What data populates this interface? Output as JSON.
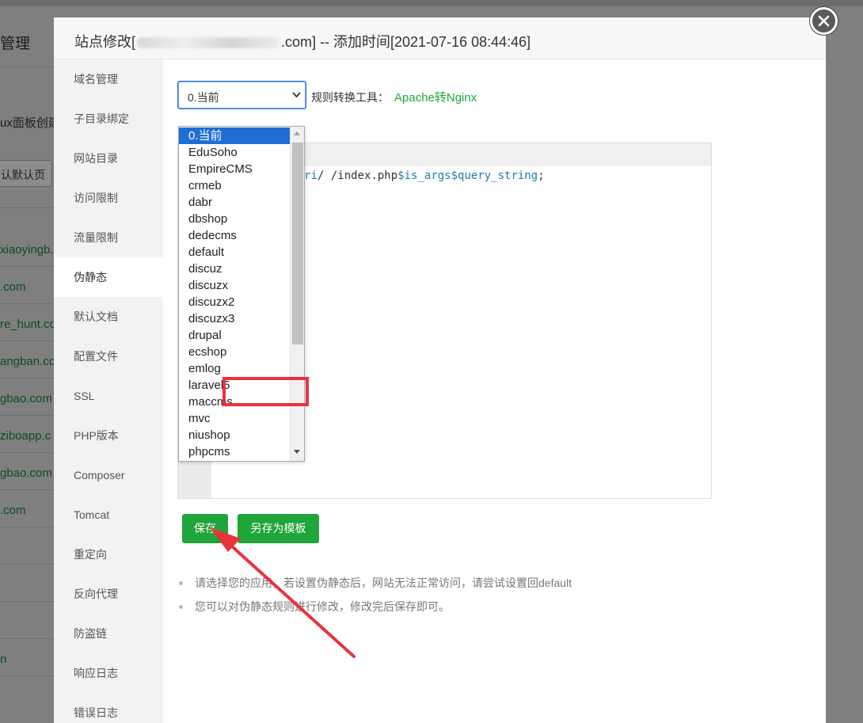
{
  "background": {
    "title": "管理",
    "text_1": "ux面板创建",
    "button": "认默认页",
    "links": [
      "xiaoyingb.",
      ".com",
      "re_hunt.co",
      "angban.co",
      "gbao.com",
      "ziboapp.c",
      "gbao.com",
      ".com",
      "n"
    ]
  },
  "modal": {
    "title_prefix": "站点修改[",
    "title_suffix": ".com] -- 添加时间[2021-07-16 08:44:46]"
  },
  "side_nav": [
    "域名管理",
    "子目录绑定",
    "网站目录",
    "访问限制",
    "流量限制",
    "伪静态",
    "默认文档",
    "配置文件",
    "SSL",
    "PHP版本",
    "Composer",
    "Tomcat",
    "重定向",
    "反向代理",
    "防盗链",
    "响应日志",
    "错误日志"
  ],
  "rewrite": {
    "selected": "0.当前",
    "tool_label": "规则转换工具：",
    "tool_link": "Apache转Nginx",
    "code_prefix": "ri ",
    "code_var1": "$uri",
    "code_mid": "/ /index.php",
    "code_var2": "$is_args$query_string",
    "code_end": ";",
    "options": [
      "0.当前",
      "EduSoho",
      "EmpireCMS",
      "crmeb",
      "dabr",
      "dbshop",
      "dedecms",
      "default",
      "discuz",
      "discuzx",
      "discuzx2",
      "discuzx3",
      "drupal",
      "ecshop",
      "emlog",
      "laravel5",
      "maccms",
      "mvc",
      "niushop",
      "phpcms"
    ],
    "save_label": "保存",
    "template_label": "另存为模板",
    "tips": [
      "请选择您的应用，若设置伪静态后，网站无法正常访问，请尝试设置回default",
      "您可以对伪静态规则进行修改，修改完后保存即可。"
    ]
  },
  "colors": {
    "accent": "#20a53a",
    "selection": "#1e6ed6",
    "annotation": "#e8333c"
  }
}
